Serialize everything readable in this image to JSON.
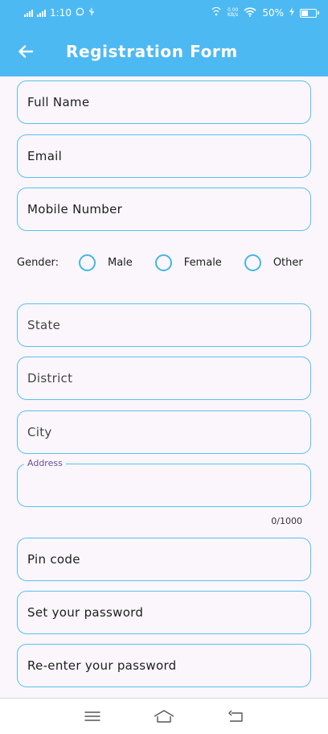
{
  "status_bar": {
    "time": "1:10",
    "net_speed_value": "0.00",
    "net_speed_unit": "KB/s",
    "battery_percent": "50%",
    "battery_level": 0.5
  },
  "app_bar": {
    "title": "Registration Form",
    "back_icon": "arrow-left-icon"
  },
  "form": {
    "full_name": {
      "placeholder": "Full Name"
    },
    "email": {
      "placeholder": "Email"
    },
    "mobile": {
      "placeholder": "Mobile Number"
    },
    "gender": {
      "label": "Gender:",
      "options": [
        "Male",
        "Female",
        "Other"
      ]
    },
    "state": {
      "placeholder": "State"
    },
    "district": {
      "placeholder": "District"
    },
    "city": {
      "placeholder": "City"
    },
    "address": {
      "label": "Address",
      "counter": "0/1000"
    },
    "pin_code": {
      "placeholder": "Pin code"
    },
    "password": {
      "placeholder": "Set your password"
    },
    "confirm_password": {
      "placeholder": "Re-enter your password"
    }
  },
  "nav_bar": {
    "menu_icon": "menu-icon",
    "home_icon": "home-icon",
    "back_icon": "back-nav-icon"
  },
  "colors": {
    "accent": "#4db9f3",
    "field_border": "#5bc0ea",
    "radio_border": "#42b7e8",
    "background": "#faf6fc"
  }
}
